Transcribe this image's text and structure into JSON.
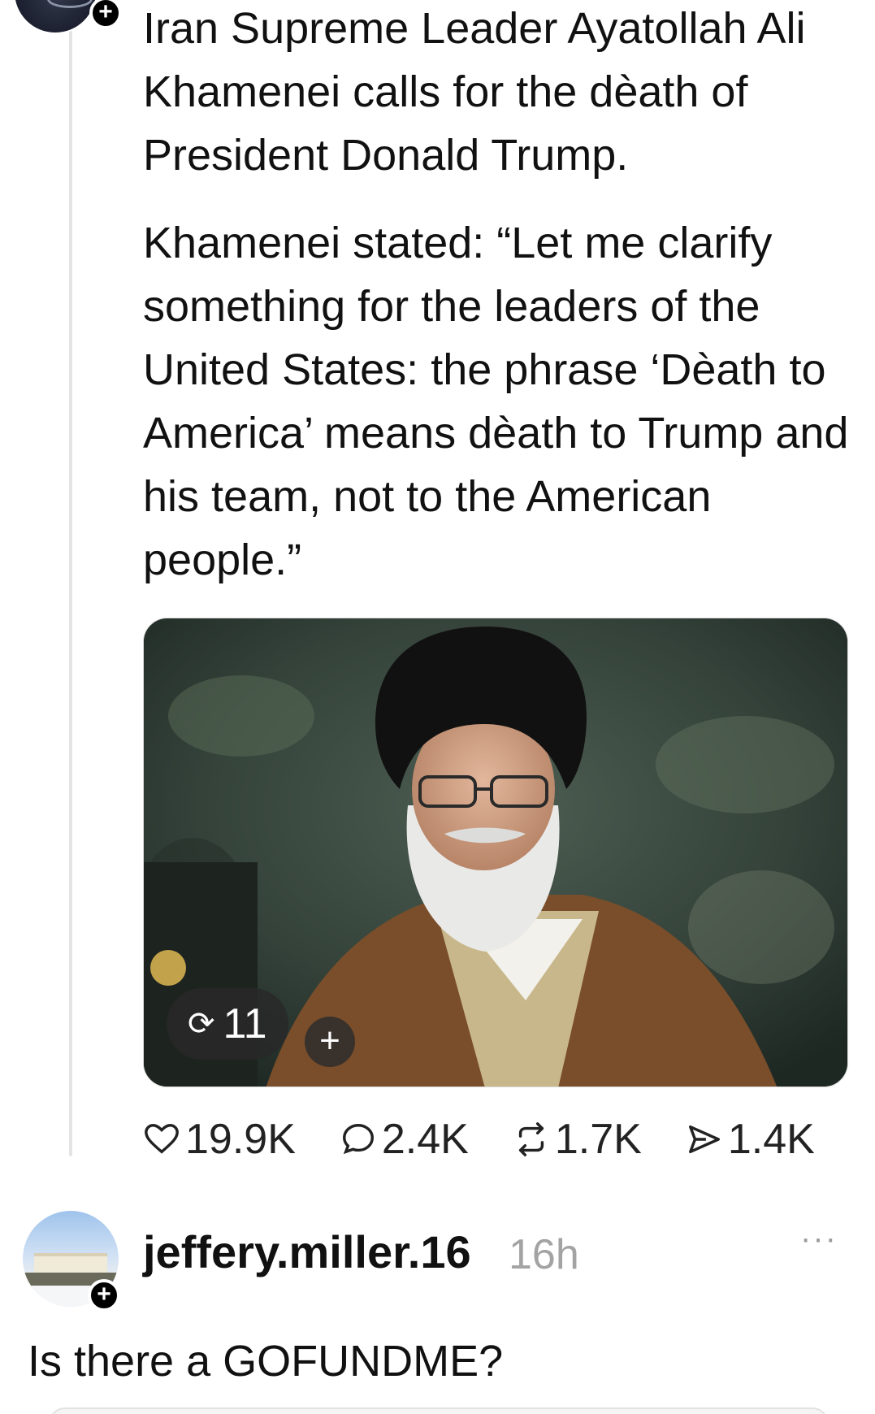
{
  "post": {
    "paragraph1": "Iran Supreme Leader Ayatollah Ali Khamenei calls for the dèath of  President Donald Trump.",
    "paragraph2": "Khamenei stated: “Let me clarify something for the leaders of the United States: the phrase ‘Dèath to America’ means dèath to Trump and his team, not to the American people.”",
    "media": {
      "repost_count": "11",
      "plus": "+"
    },
    "stats": {
      "likes": "19.9K",
      "comments": "2.4K",
      "reposts": "1.7K",
      "shares": "1.4K"
    }
  },
  "reply": {
    "username": "jeffery.miller.16",
    "time": "16h",
    "more": "···",
    "text": "Is there a GOFUNDME?"
  },
  "badges": {
    "plus": "+"
  },
  "icons": {
    "like": "heart-icon",
    "comment": "comment-bubble-icon",
    "repost": "repost-icon",
    "share": "send-icon"
  }
}
